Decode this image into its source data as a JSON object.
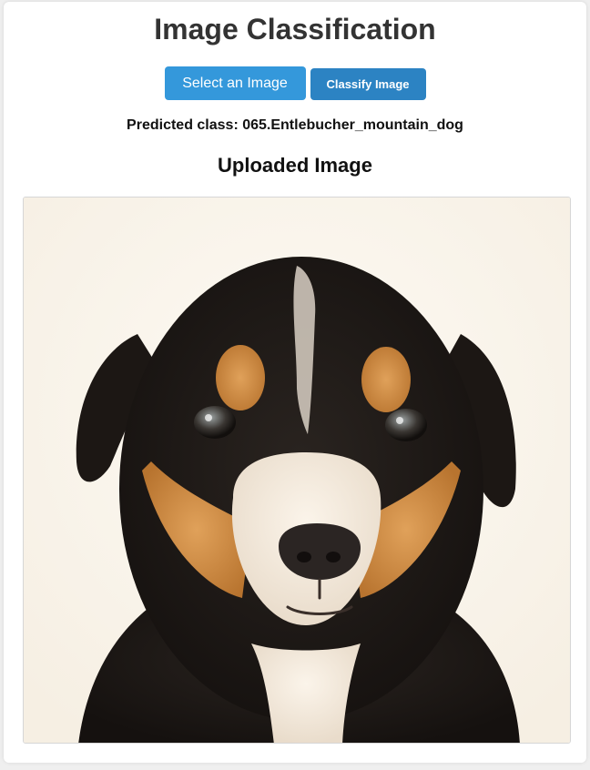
{
  "page": {
    "title": "Image Classification",
    "select_button_label": "Select an Image",
    "classify_button_label": "Classify Image",
    "prediction_text": "Predicted class: 065.Entlebucher_mountain_dog",
    "uploaded_heading": "Uploaded Image"
  },
  "colors": {
    "accent": "#3498db",
    "accent_dark": "#2c83c3",
    "title_text": "#333333"
  },
  "uploaded_image": {
    "subject": "puppy-photo"
  }
}
